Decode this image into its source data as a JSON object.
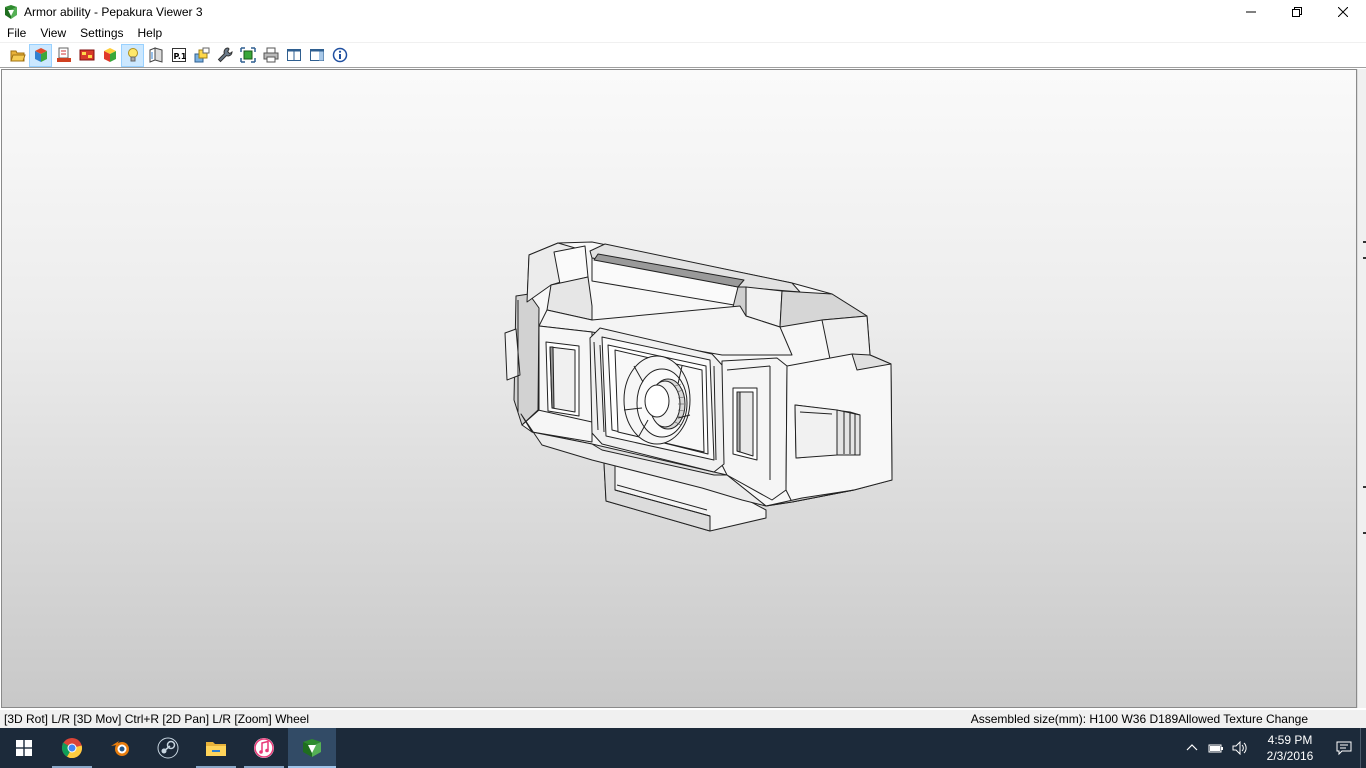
{
  "window": {
    "title": "Armor ability - Pepakura Viewer 3",
    "controls": [
      "minimize-icon",
      "restore-icon",
      "close-icon"
    ]
  },
  "menu": [
    "File",
    "View",
    "Settings",
    "Help"
  ],
  "toolbar": {
    "buttons": [
      {
        "icon": "open-folder-icon"
      },
      {
        "icon": "3d-view-icon",
        "active": true
      },
      {
        "icon": "2d-view-icon"
      },
      {
        "icon": "texture-icon"
      },
      {
        "icon": "colored-model-icon"
      },
      {
        "icon": "lightbulb-icon",
        "active": true
      },
      {
        "icon": "unfold-icon"
      },
      {
        "icon": "page-number-icon"
      },
      {
        "icon": "layers-icon"
      },
      {
        "icon": "wrench-icon"
      },
      {
        "icon": "arrange-icon"
      },
      {
        "icon": "print-icon"
      },
      {
        "icon": "single-pane-icon"
      },
      {
        "icon": "split-pane-icon"
      },
      {
        "icon": "info-icon"
      }
    ]
  },
  "status": {
    "left": "[3D Rot] L/R [3D Mov] Ctrl+R [2D Pan] L/R [Zoom] Wheel",
    "right": "Assembled size(mm): H100 W36 D189Allowed Texture Change"
  },
  "taskbar": {
    "apps": [
      {
        "icon": "chrome-icon",
        "running": true
      },
      {
        "icon": "blender-icon",
        "running": false
      },
      {
        "icon": "steam-icon",
        "running": false
      },
      {
        "icon": "file-explorer-icon",
        "running": true
      },
      {
        "icon": "itunes-icon",
        "running": true
      },
      {
        "icon": "pepakura-icon",
        "running": true,
        "current": true
      }
    ],
    "clock": {
      "time": "4:59 PM",
      "date": "2/3/2016"
    }
  },
  "colors": {
    "taskbar": "#1c2a3a",
    "accent": "#9fc4ea",
    "toolbar_active": "#cce8ff"
  }
}
